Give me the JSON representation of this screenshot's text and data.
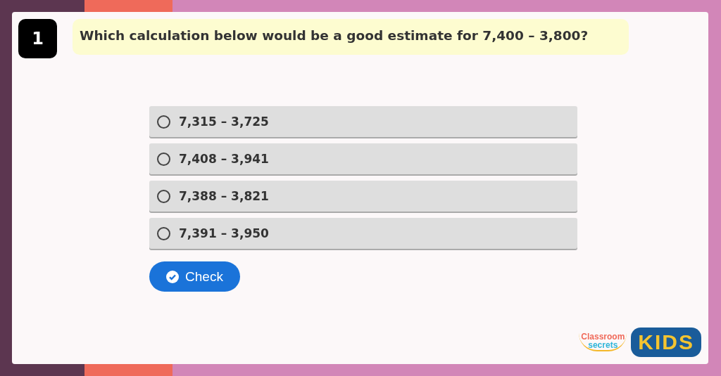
{
  "question": {
    "number": "1",
    "text": "Which calculation below would be a good estimate for 7,400 – 3,800?"
  },
  "options": [
    {
      "label": "7,315 – 3,725",
      "selected": false
    },
    {
      "label": "7,408 – 3,941",
      "selected": false
    },
    {
      "label": "7,388 – 3,821",
      "selected": false
    },
    {
      "label": "7,391 – 3,950",
      "selected": false
    }
  ],
  "check_button": {
    "label": "Check"
  },
  "logo": {
    "line_1": "Classroom",
    "line_2": "secrets",
    "badge": "KIDS"
  }
}
